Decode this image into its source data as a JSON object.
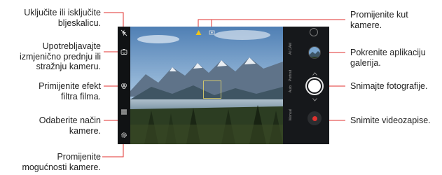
{
  "labels": {
    "flash": [
      "Uključite ili isključite",
      "bljeskalicu."
    ],
    "switch_camera": [
      "Upotrebljavajte",
      "izmjenično prednju ili",
      "stražnju kameru."
    ],
    "film_effect": [
      "Primijenite efekt",
      "filtra filma."
    ],
    "mode": [
      "Odaberite način",
      "kamere."
    ],
    "settings": [
      "Promijenite",
      "mogućnosti kamere."
    ],
    "angle": [
      "Promijenite kut",
      "kamere."
    ],
    "gallery": [
      "Pokrenite aplikaciju",
      "galerija."
    ],
    "photo": [
      "Snimajte fotografije."
    ],
    "video": [
      "Snimite videozapise."
    ]
  },
  "camera_modes": [
    "Portrait",
    "AI CAM",
    "Auto",
    "Manual"
  ],
  "icons": {
    "flash": "flash-off-icon",
    "switch": "switch-camera-icon",
    "film": "film-effect-icon",
    "mode": "camera-mode-icon",
    "settings": "settings-gear-icon",
    "angle_wide": "wide-angle-icon",
    "angle_normal": "normal-angle-icon"
  },
  "colors": {
    "leader_line": "#e0322f",
    "record": "#e0322f",
    "bar": "#101214"
  }
}
